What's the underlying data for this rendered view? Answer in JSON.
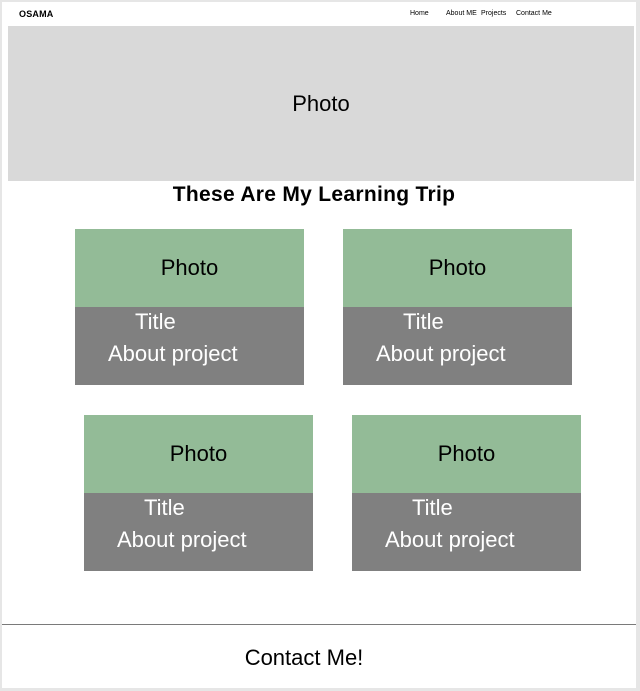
{
  "nav": {
    "logo": "OSAMA",
    "links": [
      "Home",
      "About ME",
      "Projects",
      "Contact Me"
    ]
  },
  "hero": {
    "label": "Photo"
  },
  "section": {
    "title": "These Are My Learning Trip"
  },
  "cards": [
    {
      "photo": "Photo",
      "title": "Title",
      "about": "About project"
    },
    {
      "photo": "Photo",
      "title": "Title",
      "about": "About project"
    },
    {
      "photo": "Photo",
      "title": "Title",
      "about": "About project"
    },
    {
      "photo": "Photo",
      "title": "Title",
      "about": "About project"
    }
  ],
  "footer": {
    "contact": "Contact Me!"
  },
  "colors": {
    "hero_bg": "#d9d9d9",
    "card_photo_bg": "#93bb97",
    "card_body_bg": "#808080"
  }
}
